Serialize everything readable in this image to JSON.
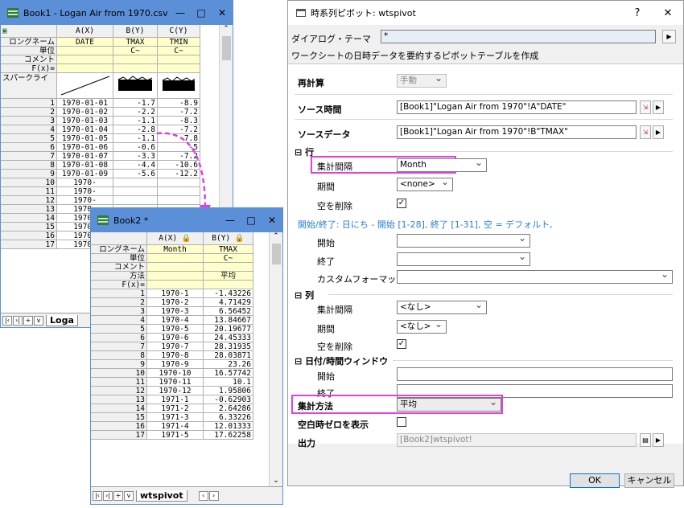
{
  "book1": {
    "title": "Book1 - Logan Air from 1970.csv *",
    "controls": [
      "—",
      "□",
      "✕"
    ],
    "columns": [
      "A(X)",
      "B(Y)",
      "C(Y)"
    ],
    "meta_labels": [
      "ロングネーム",
      "単位",
      "コメント",
      "F(x)=",
      "スパークライ"
    ],
    "long_names": [
      "DATE",
      "TMAX",
      "TMIN"
    ],
    "units": [
      "",
      "C~",
      "C~"
    ],
    "rows": [
      [
        "1",
        "1970-01-01",
        "-1.7",
        "-8.9"
      ],
      [
        "2",
        "1970-01-02",
        "-2.2",
        "-7.2"
      ],
      [
        "3",
        "1970-01-03",
        "-1.1",
        "-8.3"
      ],
      [
        "4",
        "1970-01-04",
        "-2.8",
        "-7.2"
      ],
      [
        "5",
        "1970-01-05",
        "-1.1",
        "-7.8"
      ],
      [
        "6",
        "1970-01-06",
        "-0.6",
        "-5"
      ],
      [
        "7",
        "1970-01-07",
        "-3.3",
        "-7.2"
      ],
      [
        "8",
        "1970-01-08",
        "-4.4",
        "-10.6"
      ],
      [
        "9",
        "1970-01-09",
        "-5.6",
        "-12.2"
      ],
      [
        "10",
        "1970-",
        "",
        ""
      ],
      [
        "11",
        "1970-",
        "",
        ""
      ],
      [
        "12",
        "1970-",
        "",
        ""
      ],
      [
        "13",
        "1970-",
        "",
        ""
      ],
      [
        "14",
        "1970-",
        "",
        ""
      ],
      [
        "15",
        "1970-",
        "",
        ""
      ],
      [
        "16",
        "1970-",
        "",
        ""
      ],
      [
        "17",
        "1970-",
        "",
        ""
      ]
    ],
    "tab": "Loga"
  },
  "book2": {
    "title": "Book2 *",
    "controls": [
      "—",
      "□",
      "✕"
    ],
    "columns": [
      "A(X)",
      "B(Y)"
    ],
    "meta_labels": [
      "ロングネーム",
      "単位",
      "コメント",
      "方法",
      "F(x)="
    ],
    "long_names": [
      "Month",
      "TMAX"
    ],
    "units": [
      "",
      "C~"
    ],
    "methods": [
      "",
      "平均"
    ],
    "rows": [
      [
        "1",
        "1970-1",
        "-1.43226"
      ],
      [
        "2",
        "1970-2",
        "4.71429"
      ],
      [
        "3",
        "1970-3",
        "6.56452"
      ],
      [
        "4",
        "1970-4",
        "13.84667"
      ],
      [
        "5",
        "1970-5",
        "20.19677"
      ],
      [
        "6",
        "1970-6",
        "24.45333"
      ],
      [
        "7",
        "1970-7",
        "28.31935"
      ],
      [
        "8",
        "1970-8",
        "28.03871"
      ],
      [
        "9",
        "1970-9",
        "23.26"
      ],
      [
        "10",
        "1970-10",
        "16.57742"
      ],
      [
        "11",
        "1970-11",
        "10.1"
      ],
      [
        "12",
        "1970-12",
        "1.95806"
      ],
      [
        "13",
        "1971-1",
        "-0.62903"
      ],
      [
        "14",
        "1971-2",
        "2.64286"
      ],
      [
        "15",
        "1971-3",
        "6.33226"
      ],
      [
        "16",
        "1971-4",
        "12.01333"
      ],
      [
        "17",
        "1971-5",
        "17.62258"
      ]
    ],
    "tab": "wtspivot"
  },
  "dialog": {
    "title": "時系列ピボット: wtspivot",
    "help": "?",
    "close": "✕",
    "theme_label": "ダイアログ・テーマ",
    "theme_value": "*",
    "description": "ワークシートの日時データを要約するピボットテーブルを作成",
    "recalc_label": "再計算",
    "recalc_value": "手動",
    "source_time_label": "ソース時間",
    "source_time_value": "[Book1]\"Logan Air from 1970\"!A\"DATE\"",
    "source_data_label": "ソースデータ",
    "source_data_value": "[Book1]\"Logan Air from 1970\"!B\"TMAX\"",
    "row_section": "行",
    "row_interval_label": "集計間隔",
    "row_interval_value": "Month",
    "row_period_label": "期間",
    "row_period_value": "<none>",
    "row_remove_empty_label": "空を削除",
    "hint": "開始/終了: 日にち - 開始 [1-28], 終了 [1-31], 空 = デフォルト,",
    "start_label": "開始",
    "end_label": "終了",
    "custom_format_label": "カスタムフォーマット",
    "col_section": "列",
    "col_interval_label": "集計間隔",
    "col_interval_value": "<なし>",
    "col_period_label": "期間",
    "col_period_value": "<なし>",
    "col_remove_empty_label": "空を削除",
    "window_section": "日付/時間ウィンドウ",
    "win_start_label": "開始",
    "win_end_label": "終了",
    "method_label": "集計方法",
    "method_value": "平均",
    "show_zero_label": "空白時ゼロを表示",
    "output_label": "出力",
    "output_value": "[Book2]wtspivot!",
    "ok": "OK",
    "cancel": "キャンセル"
  },
  "colors": {
    "accent": "#5b8fd8",
    "highlight": "#e040e0",
    "meta_yellow": "#ffffcc"
  }
}
